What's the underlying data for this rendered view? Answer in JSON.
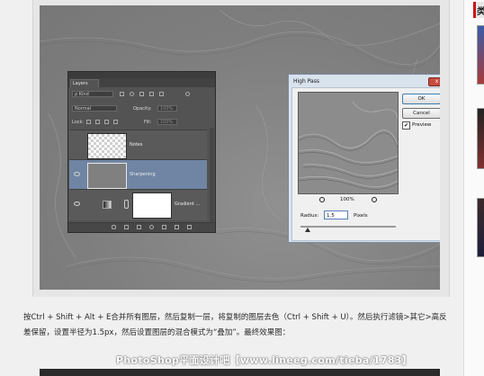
{
  "layers_panel": {
    "tab": "Layers",
    "kind_filter": "ρ Kind",
    "blend_mode": "Normal",
    "opacity_label": "Opacity:",
    "opacity_value": "100%",
    "lock_label": "Lock:",
    "fill_label": "Fill:",
    "fill_value": "100%",
    "layers": [
      {
        "name": "Notes",
        "thumb": "transparent",
        "visible": false,
        "selected": false
      },
      {
        "name": "Sharpening",
        "thumb": "gray",
        "visible": true,
        "selected": true
      },
      {
        "name": "Gradient ...",
        "thumb": "white",
        "visible": true,
        "selected": false
      }
    ]
  },
  "high_pass_dialog": {
    "title": "High Pass",
    "close": "x",
    "ok": "OK",
    "cancel": "Cancel",
    "preview_label": "Preview",
    "preview_checked": true,
    "zoom_value": "100%",
    "radius_label": "Radius:",
    "radius_value": "1.5",
    "radius_unit": "Pixels"
  },
  "caption": {
    "text": "按Ctrl + Shift + Alt + E合并所有图层，然后复制一层，将复制的图层去色（Ctrl + Shift + U）。然后执行滤镜>其它>高反差保留，设置半径为1.5px，然后设置图层的混合模式为“叠加”。最终效果图："
  },
  "watermark": "PhotoShop平面设计吧【www.lineeg.com/tieba/1783】",
  "sidebar": {
    "heading_char": "类"
  }
}
